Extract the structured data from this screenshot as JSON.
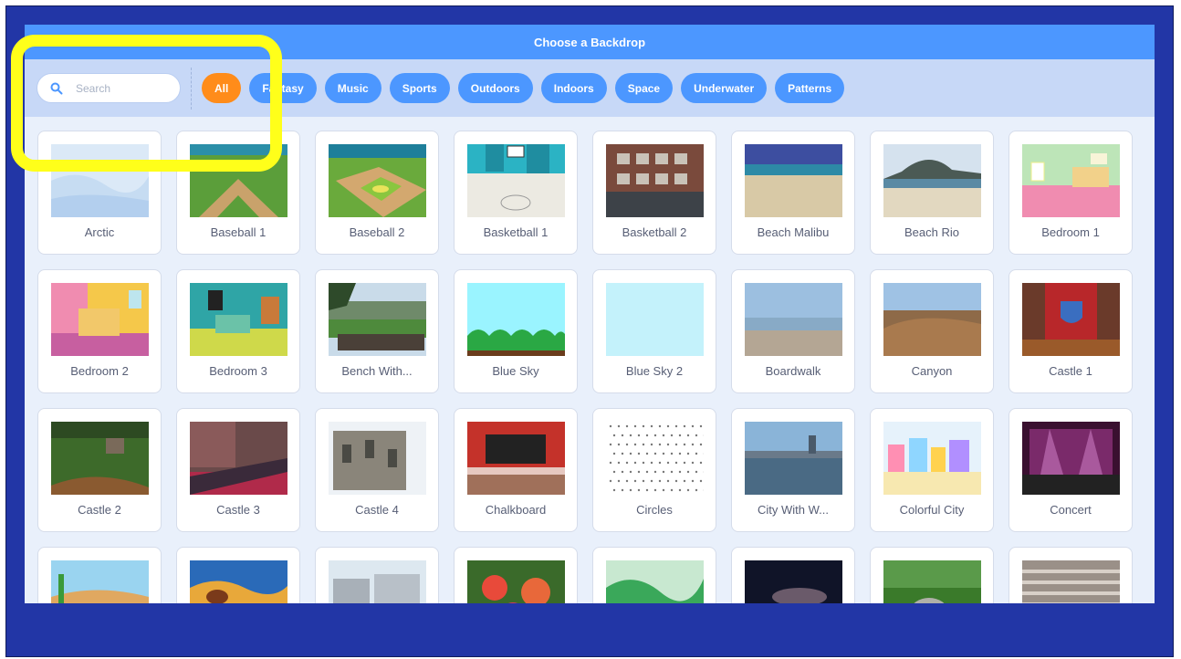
{
  "modal": {
    "title": "Choose a Backdrop"
  },
  "search": {
    "placeholder": "Search",
    "icon": "search-icon"
  },
  "tags": [
    {
      "label": "All",
      "active": true
    },
    {
      "label": "Fantasy",
      "active": false
    },
    {
      "label": "Music",
      "active": false
    },
    {
      "label": "Sports",
      "active": false
    },
    {
      "label": "Outdoors",
      "active": false
    },
    {
      "label": "Indoors",
      "active": false
    },
    {
      "label": "Space",
      "active": false
    },
    {
      "label": "Underwater",
      "active": false
    },
    {
      "label": "Patterns",
      "active": false
    }
  ],
  "backdrops": [
    {
      "name": "Arctic"
    },
    {
      "name": "Baseball 1"
    },
    {
      "name": "Baseball 2"
    },
    {
      "name": "Basketball 1"
    },
    {
      "name": "Basketball 2"
    },
    {
      "name": "Beach Malibu"
    },
    {
      "name": "Beach Rio"
    },
    {
      "name": "Bedroom 1"
    },
    {
      "name": "Bedroom 2"
    },
    {
      "name": "Bedroom 3"
    },
    {
      "name": "Bench With..."
    },
    {
      "name": "Blue Sky"
    },
    {
      "name": "Blue Sky 2"
    },
    {
      "name": "Boardwalk"
    },
    {
      "name": "Canyon"
    },
    {
      "name": "Castle 1"
    },
    {
      "name": "Castle 2"
    },
    {
      "name": "Castle 3"
    },
    {
      "name": "Castle 4"
    },
    {
      "name": "Chalkboard"
    },
    {
      "name": "Circles"
    },
    {
      "name": "City With W..."
    },
    {
      "name": "Colorful City"
    },
    {
      "name": "Concert"
    },
    {
      "name": ""
    },
    {
      "name": ""
    },
    {
      "name": ""
    },
    {
      "name": ""
    },
    {
      "name": ""
    },
    {
      "name": ""
    },
    {
      "name": ""
    },
    {
      "name": ""
    }
  ],
  "colors": {
    "header": "#4c97ff",
    "tag": "#4c97ff",
    "tag_active": "#ff8c1a",
    "highlight": "#ffff1a",
    "frame": "#2236a6"
  }
}
